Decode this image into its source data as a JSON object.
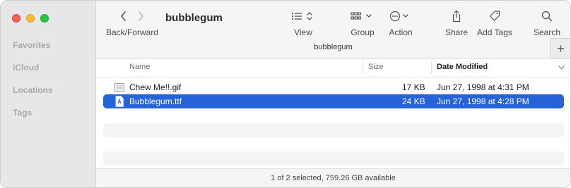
{
  "sidebar": {
    "sections": [
      "Favorites",
      "iCloud",
      "Locations",
      "Tags"
    ]
  },
  "toolbar": {
    "nav_label": "Back/Forward",
    "title": "bubblegum",
    "view_label": "View",
    "group_label": "Group",
    "action_label": "Action",
    "share_label": "Share",
    "add_tags_label": "Add Tags",
    "search_label": "Search",
    "path_label": "bubblegum",
    "plus_label": "+"
  },
  "columns": {
    "name": "Name",
    "size": "Size",
    "date_modified": "Date Modified"
  },
  "files": [
    {
      "name": "Chew Me!!.gif",
      "size": "17 KB",
      "date": "Jun 27, 1998 at 4:31 PM",
      "icon": "gif-file-icon",
      "selected": false
    },
    {
      "name": "Bubblegum.ttf",
      "size": "24 KB",
      "date": "Jun 27, 1998 at 4:28 PM",
      "icon": "font-file-icon",
      "selected": true
    }
  ],
  "status": "1 of 2 selected, 759.26 GB available",
  "colors": {
    "selection": "#2463d8",
    "close": "#fe5f57",
    "minimize": "#febc2e",
    "zoom": "#28c840"
  }
}
